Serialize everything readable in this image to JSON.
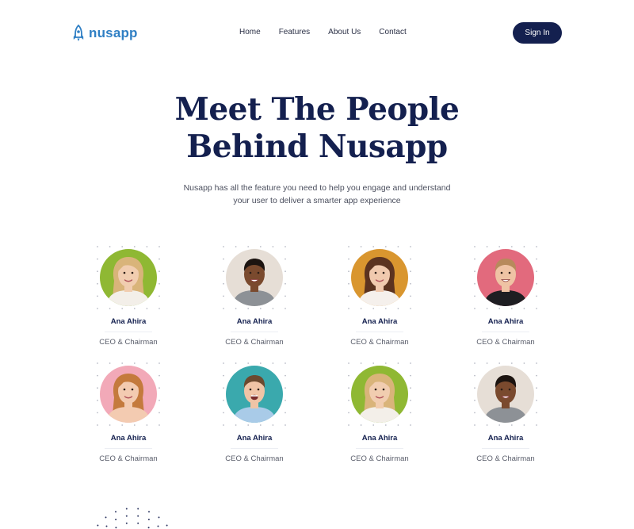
{
  "brand": {
    "name": "nusapp",
    "icon": "rocket-icon",
    "color": "#2f7fc4"
  },
  "nav": {
    "items": [
      "Home",
      "Features",
      "About Us",
      "Contact"
    ]
  },
  "signin": {
    "label": "Sign In",
    "color": "#14204f"
  },
  "hero": {
    "title_line1": "Meet The People",
    "title_line2": "Behind Nusapp",
    "subtitle_line1": "Nusapp has all the feature you need to help you engage and understand",
    "subtitle_line2": "your user to deliver a smarter app experience"
  },
  "team": [
    {
      "name": "Ana Ahira",
      "role": "CEO & Chairman",
      "bg": "#8fb833",
      "photo": "woman-blonde"
    },
    {
      "name": "Ana Ahira",
      "role": "CEO & Chairman",
      "bg": "#e6ded6",
      "photo": "man-dark"
    },
    {
      "name": "Ana Ahira",
      "role": "CEO & Chairman",
      "bg": "#d9962f",
      "photo": "woman-brunette"
    },
    {
      "name": "Ana Ahira",
      "role": "CEO & Chairman",
      "bg": "#e26a7d",
      "photo": "man-light"
    },
    {
      "name": "Ana Ahira",
      "role": "CEO & Chairman",
      "bg": "#f2a9b8",
      "photo": "woman-ginger"
    },
    {
      "name": "Ana Ahira",
      "role": "CEO & Chairman",
      "bg": "#3aa9ad",
      "photo": "man-laughing"
    },
    {
      "name": "Ana Ahira",
      "role": "CEO & Chairman",
      "bg": "#8fb833",
      "photo": "woman-blonde"
    },
    {
      "name": "Ana Ahira",
      "role": "CEO & Chairman",
      "bg": "#e6ded6",
      "photo": "man-dark"
    }
  ]
}
